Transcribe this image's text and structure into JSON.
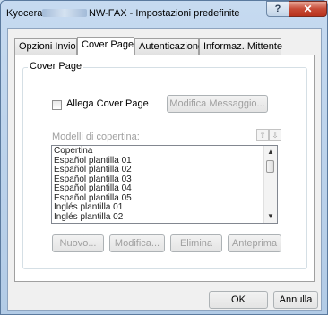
{
  "window": {
    "title_prefix": "Kyocera",
    "title_suffix": "NW-FAX - Impostazioni predefinite",
    "help_label": "?",
    "close_label": "✕"
  },
  "tabs": [
    {
      "label": "Opzioni Invio",
      "active": false
    },
    {
      "label": "Cover Page",
      "active": true
    },
    {
      "label": "Autenticazione",
      "active": false
    },
    {
      "label": "Informaz. Mittente",
      "active": false
    }
  ],
  "cover_page": {
    "group_title": "Cover Page",
    "attach_label": "Allega Cover Page",
    "attach_checked": false,
    "modify_message_label": "Modifica Messaggio...",
    "templates_label": "Modelli di copertina:",
    "move_up_label": "⇧",
    "move_down_label": "⇩",
    "templates": [
      "Copertina",
      "Español plantilla 01",
      "Español plantilla 02",
      "Español plantilla 03",
      "Español plantilla 04",
      "Español plantilla 05",
      "Inglés plantilla 01",
      "Inglés plantilla 02"
    ],
    "buttons": {
      "new": "Nuovo...",
      "modify": "Modifica...",
      "delete": "Elimina",
      "preview": "Anteprima"
    }
  },
  "footer": {
    "ok": "OK",
    "cancel": "Annulla"
  },
  "icons": {
    "scroll_up": "▲",
    "scroll_down": "▼"
  }
}
